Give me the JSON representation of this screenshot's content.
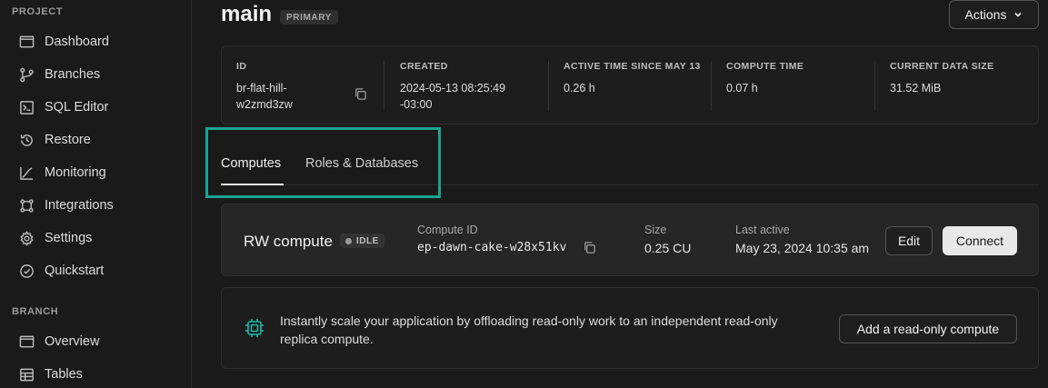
{
  "sidebar": {
    "project_label": "PROJECT",
    "project_items": [
      {
        "label": "Dashboard",
        "icon": "dashboard-icon"
      },
      {
        "label": "Branches",
        "icon": "branches-icon"
      },
      {
        "label": "SQL Editor",
        "icon": "sql-editor-icon"
      },
      {
        "label": "Restore",
        "icon": "restore-icon"
      },
      {
        "label": "Monitoring",
        "icon": "monitoring-icon"
      },
      {
        "label": "Integrations",
        "icon": "integrations-icon"
      },
      {
        "label": "Settings",
        "icon": "settings-icon"
      },
      {
        "label": "Quickstart",
        "icon": "quickstart-icon"
      }
    ],
    "branch_label": "BRANCH",
    "branch_items": [
      {
        "label": "Overview",
        "icon": "overview-icon"
      },
      {
        "label": "Tables",
        "icon": "tables-icon"
      }
    ]
  },
  "header": {
    "title": "main",
    "badge": "PRIMARY",
    "actions_label": "Actions"
  },
  "info": {
    "id_head": "ID",
    "id_line1": "br-flat-hill-",
    "id_line2": "w2zmd3zw",
    "created_head": "CREATED",
    "created_line1": "2024-05-13 08:25:49",
    "created_line2": "-03:00",
    "active_head": "ACTIVE TIME SINCE MAY 13",
    "active_val": "0.26 h",
    "compute_head": "COMPUTE TIME",
    "compute_val": "0.07 h",
    "size_head": "CURRENT DATA SIZE",
    "size_val": "31.52 MiB"
  },
  "tabs": [
    {
      "label": "Computes",
      "active": true
    },
    {
      "label": "Roles & Databases",
      "active": false
    }
  ],
  "compute": {
    "name": "RW compute",
    "status": "IDLE",
    "id_head": "Compute ID",
    "id_val": "ep-dawn-cake-w28x51kv",
    "size_head": "Size",
    "size_val": "0.25 CU",
    "last_head": "Last active",
    "last_val": "May 23, 2024 10:35 am",
    "edit_label": "Edit",
    "connect_label": "Connect"
  },
  "readonly": {
    "text": "Instantly scale your application by offloading read-only work to an independent read-only replica compute.",
    "button_label": "Add a read-only compute"
  },
  "colors": {
    "highlight": "#1aa394",
    "icon_teal": "#1fb8a8"
  }
}
